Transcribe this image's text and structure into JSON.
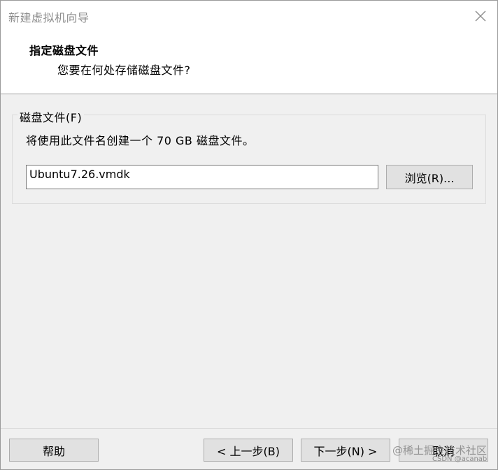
{
  "window": {
    "title": "新建虚拟机向导"
  },
  "header": {
    "title": "指定磁盘文件",
    "subtitle": "您要在何处存储磁盘文件?"
  },
  "disk_file_group": {
    "legend": "磁盘文件(F)",
    "description": "将使用此文件名创建一个 70 GB 磁盘文件。",
    "file_name_value": "Ubuntu7.26.vmdk",
    "browse_label": "浏览(R)..."
  },
  "footer": {
    "help_label": "帮助",
    "back_label": "< 上一步(B)",
    "next_label": "下一步(N) >",
    "cancel_label": "取消"
  },
  "watermark": {
    "line1": "@稀土掘金技术社区",
    "line2": "CSDN @acanab"
  },
  "colors": {
    "title_text": "#8c8c8c",
    "body_bg": "#f0f0f0",
    "button_bg": "#e1e1e1",
    "button_border": "#adadad"
  },
  "icons": {
    "close": "close-icon"
  }
}
